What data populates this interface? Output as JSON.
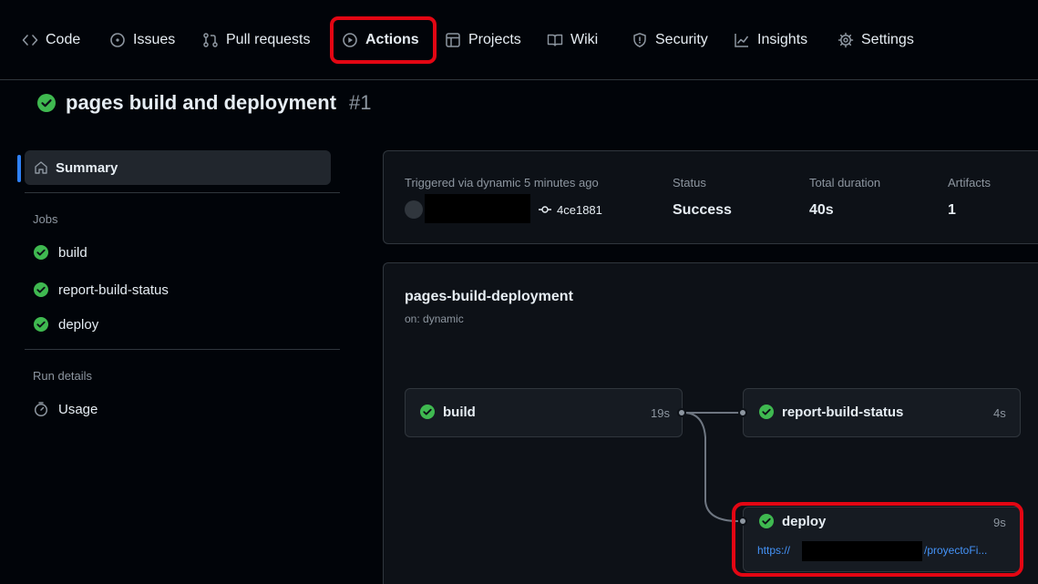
{
  "nav": {
    "items": [
      {
        "label": "Code",
        "icon": "code-icon"
      },
      {
        "label": "Issues",
        "icon": "issue-opened-icon"
      },
      {
        "label": "Pull requests",
        "icon": "git-pull-request-icon"
      },
      {
        "label": "Actions",
        "icon": "play-icon",
        "active": true
      },
      {
        "label": "Projects",
        "icon": "table-icon"
      },
      {
        "label": "Wiki",
        "icon": "book-icon"
      },
      {
        "label": "Security",
        "icon": "shield-icon"
      },
      {
        "label": "Insights",
        "icon": "graph-icon"
      },
      {
        "label": "Settings",
        "icon": "gear-icon"
      }
    ]
  },
  "run": {
    "title": "pages build and deployment",
    "number": "#1",
    "status_icon": "check-circle-fill-icon"
  },
  "sidebar": {
    "summary_label": "Summary",
    "jobs_heading": "Jobs",
    "jobs": [
      {
        "label": "build"
      },
      {
        "label": "report-build-status"
      },
      {
        "label": "deploy"
      }
    ],
    "run_details_heading": "Run details",
    "usage_label": "Usage"
  },
  "summary": {
    "triggered_label": "Triggered via dynamic 5 minutes ago",
    "commit_sha": "4ce1881",
    "status_label": "Status",
    "status_value": "Success",
    "duration_label": "Total duration",
    "duration_value": "40s",
    "artifacts_label": "Artifacts",
    "artifacts_value": "1"
  },
  "workflow": {
    "name": "pages-build-deployment",
    "trigger": "on: dynamic",
    "jobs": {
      "build": {
        "name": "build",
        "duration": "19s"
      },
      "report": {
        "name": "report-build-status",
        "duration": "4s"
      },
      "deploy": {
        "name": "deploy",
        "duration": "9s",
        "url_prefix": "https://",
        "url_suffix": "/proyectoFi..."
      }
    }
  },
  "colors": {
    "success": "#3fb950",
    "link": "#4493f8",
    "highlight": "#e30613",
    "active_indicator": "#2f81f7"
  }
}
